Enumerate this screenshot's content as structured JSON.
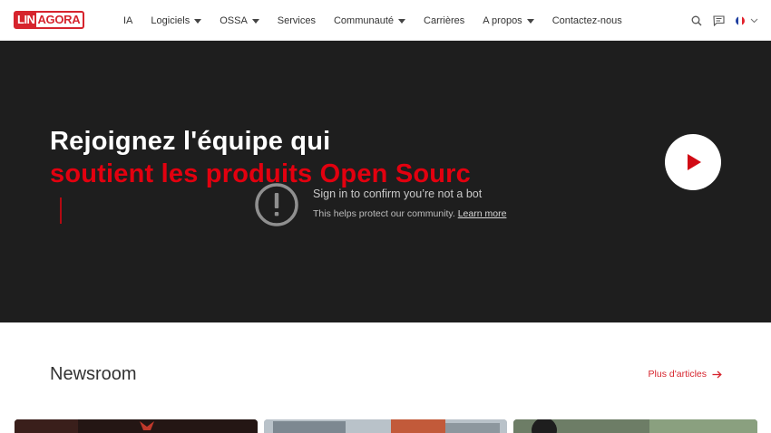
{
  "header": {
    "logo": {
      "part1": "LIN",
      "part2": "AGORA"
    },
    "nav": [
      {
        "label": "IA",
        "dropdown": false
      },
      {
        "label": "Logiciels",
        "dropdown": true
      },
      {
        "label": "OSSA",
        "dropdown": true
      },
      {
        "label": "Services",
        "dropdown": false
      },
      {
        "label": "Communauté",
        "dropdown": true
      },
      {
        "label": "Carrières",
        "dropdown": false
      },
      {
        "label": "A propos",
        "dropdown": true
      },
      {
        "label": "Contactez-nous",
        "dropdown": false
      }
    ],
    "tools": {
      "search_icon": "search-icon",
      "chat_icon": "chat-icon",
      "language_icon": "french-flag-icon"
    }
  },
  "hero": {
    "line1": "Rejoignez l'équipe qui",
    "line2": "soutient les produits Open Sourc",
    "bot_notice": {
      "title": "Sign in to confirm you’re not a bot",
      "subtitle": "This helps protect our community.",
      "link": "Learn more"
    }
  },
  "newsroom": {
    "title": "Newsroom",
    "more_link": "Plus d'articles"
  },
  "colors": {
    "brand": "#d6242d",
    "hero_bg": "#1e1e1e",
    "hero_accent": "#e3000f"
  }
}
